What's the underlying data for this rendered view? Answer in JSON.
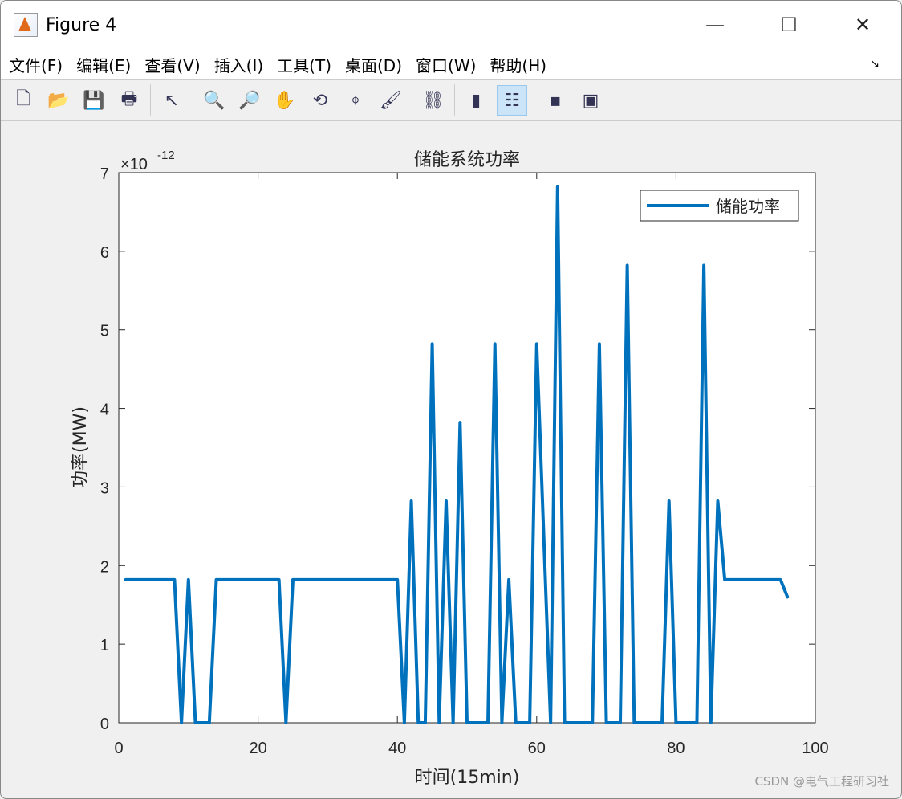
{
  "window": {
    "title": "Figure 4",
    "minimize": "—",
    "maximize": "☐",
    "close": "✕"
  },
  "menu": [
    "文件(F)",
    "编辑(E)",
    "查看(V)",
    "插入(I)",
    "工具(T)",
    "桌面(D)",
    "窗口(W)",
    "帮助(H)"
  ],
  "toolbar": [
    "new-icon",
    "open-icon",
    "save-icon",
    "print-icon",
    "|",
    "pointer-icon",
    "|",
    "zoom-in-icon",
    "zoom-out-icon",
    "pan-icon",
    "rotate-icon",
    "data-cursor-icon",
    "brush-icon",
    "|",
    "link-icon",
    "|",
    "colorbar-icon",
    "legend-icon",
    "|",
    "hide-plot-tools-icon",
    "show-plot-tools-icon"
  ],
  "toolbar_glyphs": [
    "🗋",
    "📂",
    "💾",
    "🖶",
    "|",
    "↖",
    "|",
    "🔍",
    "🔎",
    "✋",
    "⟲",
    "⌖",
    "🖌",
    "|",
    "⛓",
    "|",
    "▮",
    "☷",
    "|",
    "▪",
    "▣"
  ],
  "watermark": "CSDN @电气工程研习社",
  "chart_data": {
    "type": "line",
    "title": "储能系统功率",
    "xlabel": "时间(15min)",
    "ylabel": "功率(MW)",
    "exponent_label": "×10",
    "exponent": "-12",
    "xlim": [
      0,
      100
    ],
    "ylim": [
      0,
      7
    ],
    "xticks": [
      0,
      20,
      40,
      60,
      80,
      100
    ],
    "yticks": [
      0,
      1,
      2,
      3,
      4,
      5,
      6,
      7
    ],
    "legend": {
      "entries": [
        "储能功率"
      ],
      "placement": "top-right"
    },
    "color": "#0072bd",
    "series": [
      {
        "name": "储能功率",
        "x_start": 1,
        "values": [
          1.82,
          1.82,
          1.82,
          1.82,
          1.82,
          1.82,
          1.82,
          1.82,
          0,
          1.82,
          0,
          0,
          0,
          1.82,
          1.82,
          1.82,
          1.82,
          1.82,
          1.82,
          1.82,
          1.82,
          1.82,
          1.82,
          0,
          1.82,
          1.82,
          1.82,
          1.82,
          1.82,
          1.82,
          1.82,
          1.82,
          1.82,
          1.82,
          1.82,
          1.82,
          1.82,
          1.82,
          1.82,
          1.82,
          0,
          2.82,
          0,
          0,
          4.82,
          0,
          2.82,
          0,
          3.82,
          0,
          0,
          0,
          0,
          4.82,
          0,
          1.82,
          0,
          0,
          0,
          4.82,
          2.41,
          0,
          6.82,
          0,
          0,
          0,
          0,
          0,
          4.82,
          0,
          0,
          0,
          5.82,
          0,
          0,
          0,
          0,
          0,
          2.82,
          0,
          0,
          0,
          0,
          5.82,
          0,
          2.82,
          1.82,
          1.82,
          1.82,
          1.82,
          1.82,
          1.82,
          1.82,
          1.82,
          1.82,
          1.6
        ]
      }
    ]
  }
}
